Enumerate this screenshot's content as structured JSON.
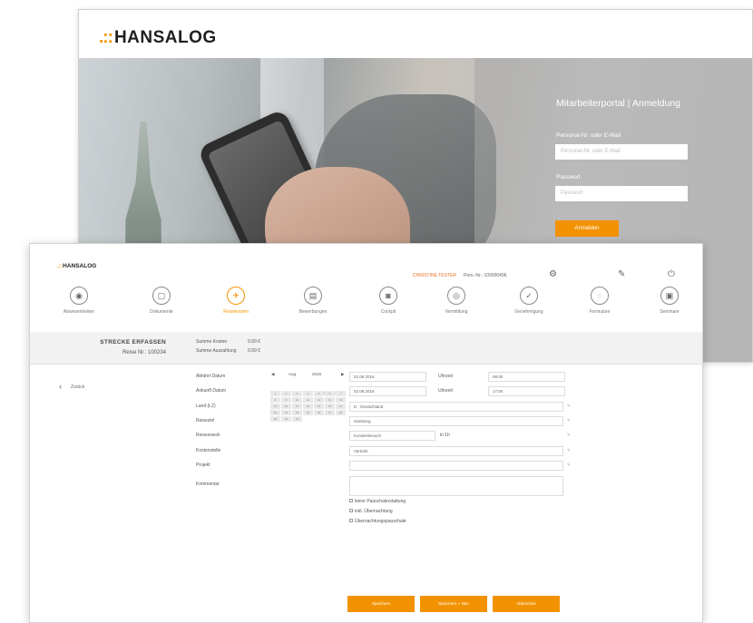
{
  "login": {
    "brand": "HANSALOG",
    "title": "Mitarbeiterportal | Anmeldung",
    "personnel_label": "Personal-Nr. oder E-Mail",
    "personnel_placeholder": "Personal-Nr. oder E-Mail",
    "password_label": "Passwort",
    "password_placeholder": "Passwort",
    "login_button": "Anmelden"
  },
  "app": {
    "brand": "HANSALOG",
    "user_name": "CHRISTINE TESTER",
    "personnel_no": "Pers.-Nr.: 100000496",
    "nav": [
      {
        "label": "Abwesenheiten",
        "icon": "◉"
      },
      {
        "label": "Dokumente",
        "icon": "▢"
      },
      {
        "label": "Reisekosten",
        "icon": "✈"
      },
      {
        "label": "Bewerbungen",
        "icon": "▤"
      },
      {
        "label": "Cockpit",
        "icon": "◙"
      },
      {
        "label": "Vermittlung",
        "icon": "◎"
      },
      {
        "label": "Genehmigung",
        "icon": "✓"
      },
      {
        "label": "Formulare",
        "icon": "◌"
      },
      {
        "label": "Seminare",
        "icon": "▣"
      }
    ],
    "active_nav_index": 2,
    "page_title": "STRECKE ERFASSEN",
    "reise_nr": "Reise Nr.: 100234",
    "summe_kosten_label": "Summe Kosten",
    "summe_kosten_value": "0.00 €",
    "summe_auszahlung_label": "Summe Auszahlung",
    "summe_auszahlung_value": "0.00 €",
    "back_label": "Zurück",
    "form": {
      "abfahrt_label": "Abfahrt Datum",
      "ankunft_label": "Ankunft Datum",
      "land_label": "Land (LZ)",
      "reiseziel_label": "Reiseziel",
      "reisezweck_label": "Reisezweck",
      "kostenstelle_label": "Kostenstelle",
      "projekt_label": "Projekt",
      "kommentar_label": "Kommentar",
      "abfahrt_date": "02.08.2016",
      "ankunft_date": "02.08.2016",
      "uhrzeit_label": "Uhrzeit",
      "abfahrt_time": "08:00",
      "ankunft_time": "17:00",
      "land_value": "D - Deutschland",
      "reiseziel_value": "Hamburg",
      "reisezweck_value": "Kundenbesuch",
      "reisezweck_extra": "in 1h",
      "kostenstelle_value": "Vertrieb",
      "projekt_value": "",
      "kommentar_value": "",
      "checks": [
        "keine Pauschalerstattung",
        "inkl. Übernachtung",
        "Übernachtungspauschale"
      ]
    },
    "calendar": {
      "month": "Aug",
      "year": "2016",
      "weekdays": [
        "Mo",
        "Di",
        "Mi",
        "Do",
        "Fr",
        "Sa",
        "So"
      ],
      "first_weekday_offset": 0,
      "days_in_month": 31
    },
    "buttons": [
      "Speichern",
      "Speichern + Neu",
      "Abbrechen"
    ]
  }
}
